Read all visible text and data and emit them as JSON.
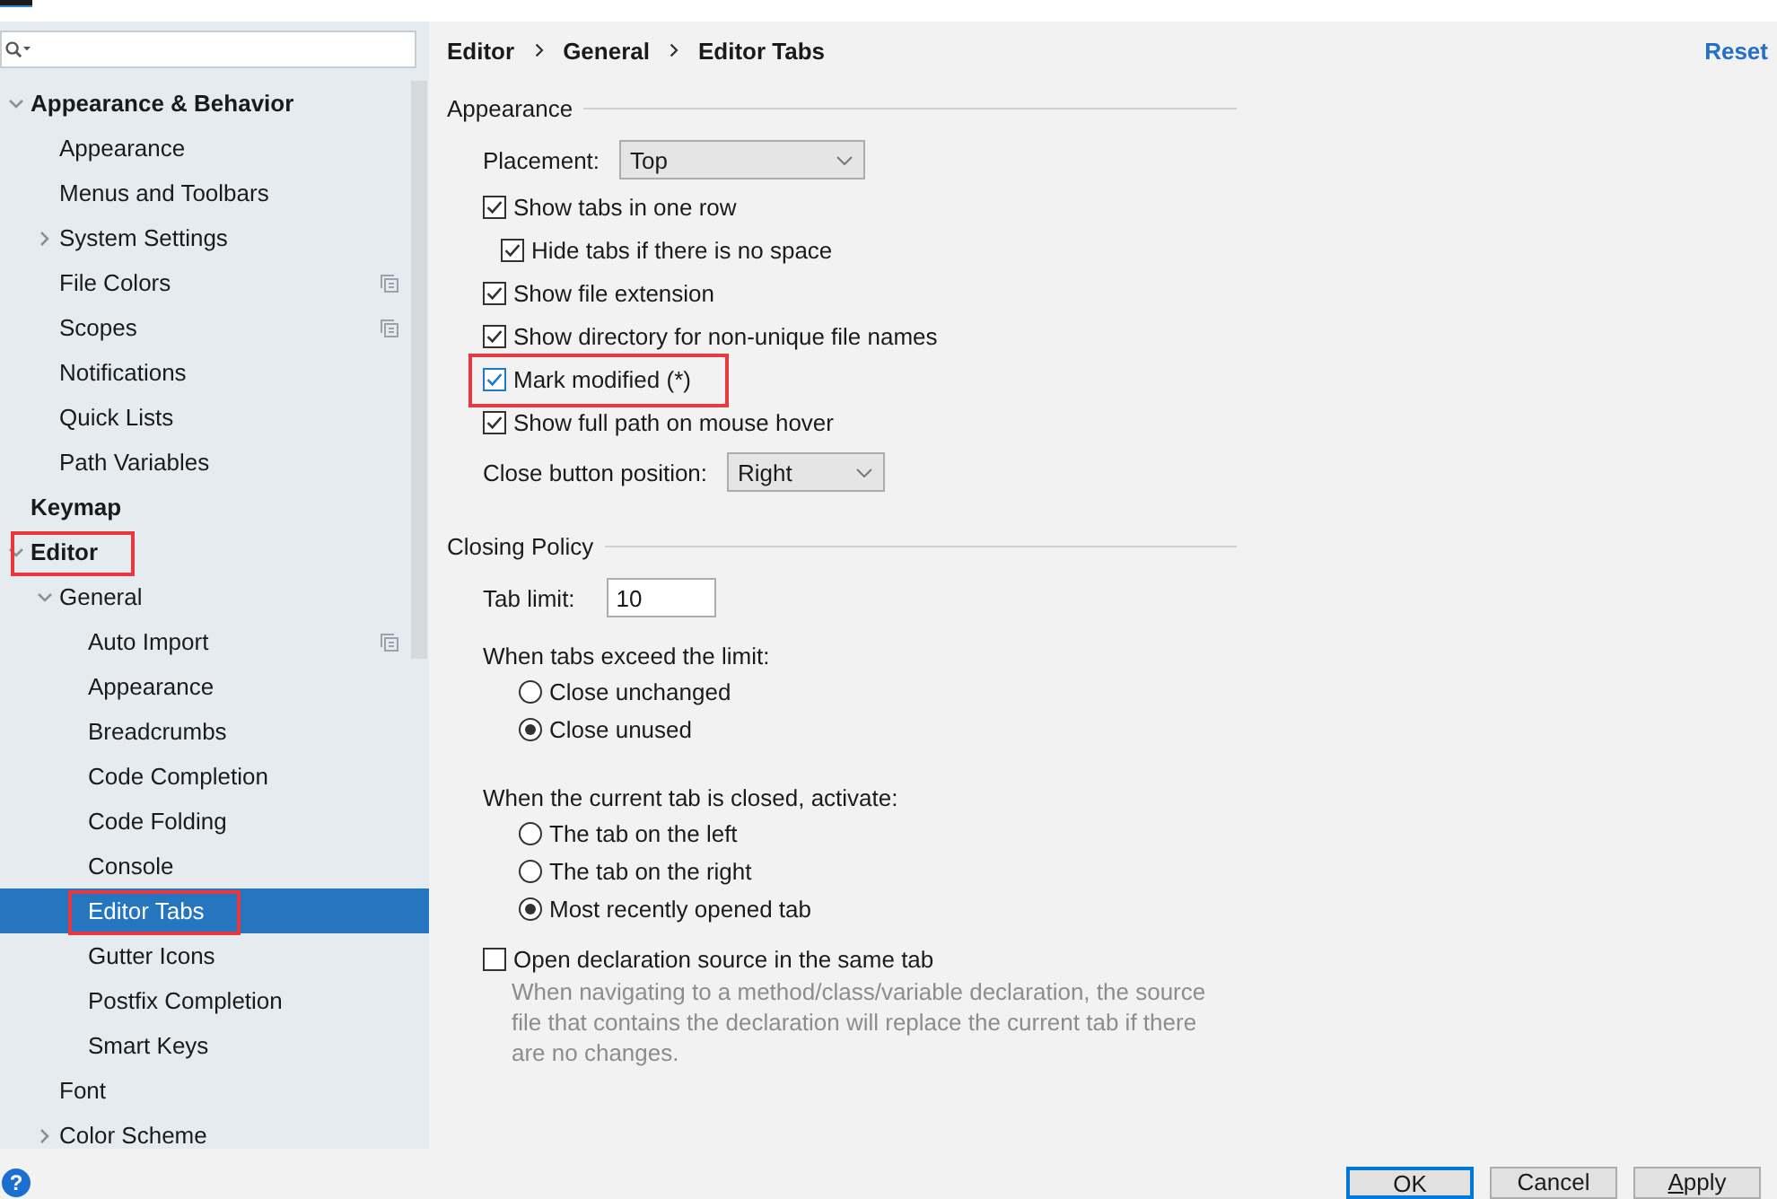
{
  "sidebar": {
    "items": [
      {
        "label": "Appearance & Behavior",
        "expanded": true,
        "selected": false,
        "children": [
          {
            "label": "Appearance",
            "selected": false
          },
          {
            "label": "Menus and Toolbars",
            "selected": false
          },
          {
            "label": "System Settings",
            "expanded": false,
            "selected": false
          },
          {
            "label": "File Colors",
            "selected": false,
            "project_scoped": true
          },
          {
            "label": "Scopes",
            "selected": false,
            "project_scoped": true
          },
          {
            "label": "Notifications",
            "selected": false
          },
          {
            "label": "Quick Lists",
            "selected": false
          },
          {
            "label": "Path Variables",
            "selected": false
          }
        ]
      },
      {
        "label": "Keymap",
        "selected": false
      },
      {
        "label": "Editor",
        "expanded": true,
        "selected": false,
        "highlighted": true,
        "children": [
          {
            "label": "General",
            "expanded": true,
            "selected": false,
            "children": [
              {
                "label": "Auto Import",
                "selected": false,
                "project_scoped": true
              },
              {
                "label": "Appearance",
                "selected": false
              },
              {
                "label": "Breadcrumbs",
                "selected": false
              },
              {
                "label": "Code Completion",
                "selected": false
              },
              {
                "label": "Code Folding",
                "selected": false
              },
              {
                "label": "Console",
                "selected": false
              },
              {
                "label": "Editor Tabs",
                "selected": true,
                "highlighted": true
              },
              {
                "label": "Gutter Icons",
                "selected": false
              },
              {
                "label": "Postfix Completion",
                "selected": false
              },
              {
                "label": "Smart Keys",
                "selected": false
              }
            ]
          },
          {
            "label": "Font",
            "selected": false
          },
          {
            "label": "Color Scheme",
            "expanded": false,
            "selected": false
          }
        ]
      }
    ]
  },
  "breadcrumb": [
    "Editor",
    "General",
    "Editor Tabs"
  ],
  "reset_link": "Reset",
  "sections": [
    {
      "title": "Appearance",
      "rows": [
        {
          "kind": "dropdown",
          "label": "Placement:",
          "value": "Top"
        },
        {
          "kind": "checkbox",
          "label": "Show tabs in one row",
          "checked": true,
          "children": [
            {
              "kind": "checkbox",
              "label": "Hide tabs if there is no space",
              "checked": true
            }
          ]
        },
        {
          "kind": "checkbox",
          "label": "Show file extension",
          "checked": true
        },
        {
          "kind": "checkbox",
          "label": "Show directory for non-unique file names",
          "checked": true
        },
        {
          "kind": "checkbox",
          "label": "Mark modified (*)",
          "checked": true,
          "focused": true,
          "highlighted": true
        },
        {
          "kind": "checkbox",
          "label": "Show full path on mouse hover",
          "checked": true
        },
        {
          "kind": "dropdown",
          "label": "Close button position:",
          "value": "Right"
        }
      ]
    },
    {
      "title": "Closing Policy",
      "rows": [
        {
          "kind": "text_field",
          "label": "Tab limit:",
          "value": "10"
        },
        {
          "kind": "radio_group",
          "label": "When tabs exceed the limit:",
          "options": [
            {
              "label": "Close unchanged",
              "selected": false
            },
            {
              "label": "Close unused",
              "selected": true
            }
          ]
        },
        {
          "kind": "radio_group",
          "label": "When the current tab is closed, activate:",
          "options": [
            {
              "label": "The tab on the left",
              "selected": false
            },
            {
              "label": "The tab on the right",
              "selected": false
            },
            {
              "label": "Most recently opened tab",
              "selected": true
            }
          ]
        },
        {
          "kind": "checkbox",
          "label": "Open declaration source in the same tab",
          "checked": false,
          "description": "When navigating to a method/class/variable declaration, the source file that contains the declaration will replace the current tab if there are no changes."
        }
      ]
    }
  ],
  "help_button": "?",
  "buttons": [
    {
      "label": "OK",
      "default": true,
      "mnemonic_underlined": false
    },
    {
      "label": "Cancel",
      "default": false,
      "mnemonic_underlined": false
    },
    {
      "label": "Apply",
      "default": false,
      "mnemonic_underlined": true
    }
  ]
}
